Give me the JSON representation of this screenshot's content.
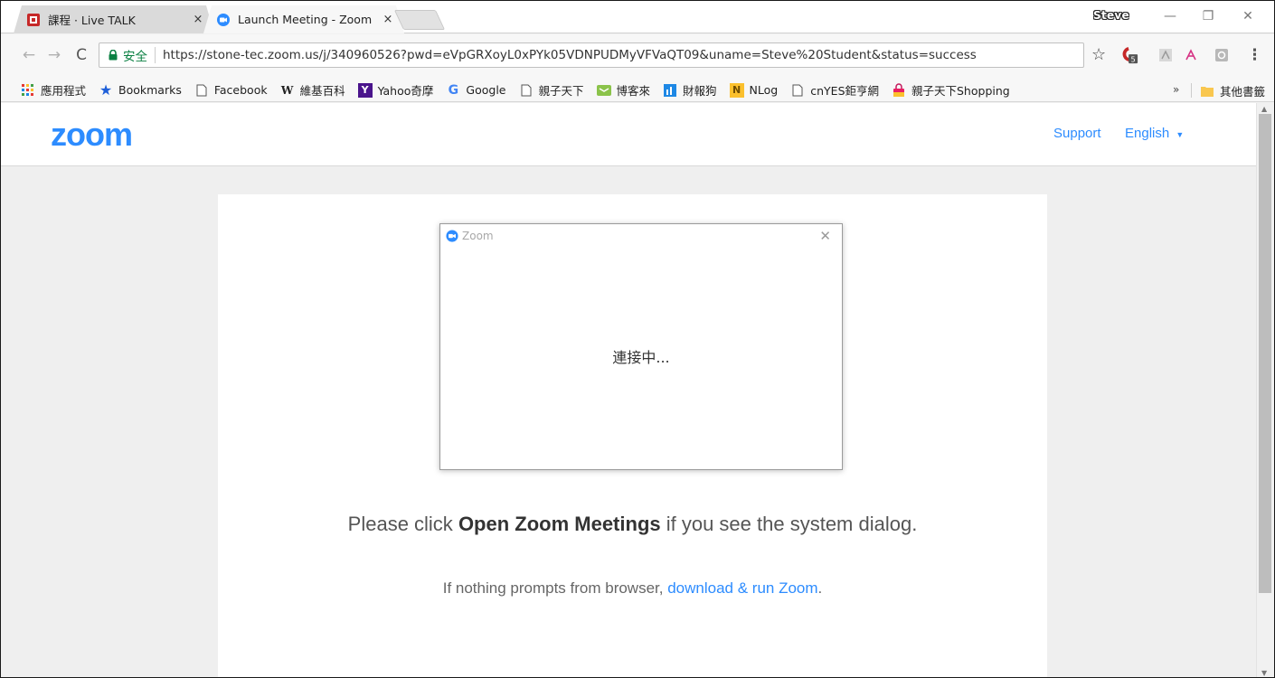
{
  "browser": {
    "tabs": [
      {
        "title": "課程 · Live TALK",
        "close": "×",
        "active": false
      },
      {
        "title": "Launch Meeting - Zoom",
        "close": "×",
        "active": true
      }
    ],
    "profile_name": "Steve",
    "window_controls": {
      "minimize": "—",
      "maximize": "❐",
      "close": "✕"
    }
  },
  "toolbar": {
    "secure_label": "安全",
    "url": "https://stone-tec.zoom.us/j/340960526?pwd=eVpGRXoyL0xPYk05VDNPUDMyVFVaQT09&uname=Steve%20Student&status=success",
    "extension_badge": "5"
  },
  "bookmarks": {
    "items": [
      {
        "label": "應用程式",
        "icon": "apps-grid-icon"
      },
      {
        "label": "Bookmarks",
        "icon": "star-icon"
      },
      {
        "label": "Facebook",
        "icon": "page-icon"
      },
      {
        "label": "維基百科",
        "icon": "wikipedia-icon"
      },
      {
        "label": "Yahoo奇摩",
        "icon": "yahoo-icon"
      },
      {
        "label": "Google",
        "icon": "google-icon"
      },
      {
        "label": "親子天下",
        "icon": "page-icon"
      },
      {
        "label": "博客來",
        "icon": "books-icon"
      },
      {
        "label": "財報狗",
        "icon": "statementdog-icon"
      },
      {
        "label": "NLog",
        "icon": "nlog-icon"
      },
      {
        "label": "cnYES鉅亨網",
        "icon": "page-icon"
      },
      {
        "label": "親子天下Shopping",
        "icon": "shopping-bag-icon"
      }
    ],
    "overflow": "»",
    "other_label": "其他書籤"
  },
  "page": {
    "logo": "zoom",
    "support_link": "Support",
    "language_link": "English",
    "dialog": {
      "title": "Zoom",
      "status": "連接中..."
    },
    "instruction_prefix": "Please click ",
    "instruction_bold": "Open Zoom Meetings",
    "instruction_suffix": " if you see the system dialog.",
    "fallback_prefix": "If nothing prompts from browser, ",
    "fallback_link": "download & run Zoom",
    "fallback_suffix": "."
  },
  "colors": {
    "zoom_blue": "#2d8cff",
    "secure_green": "#0b8043"
  }
}
